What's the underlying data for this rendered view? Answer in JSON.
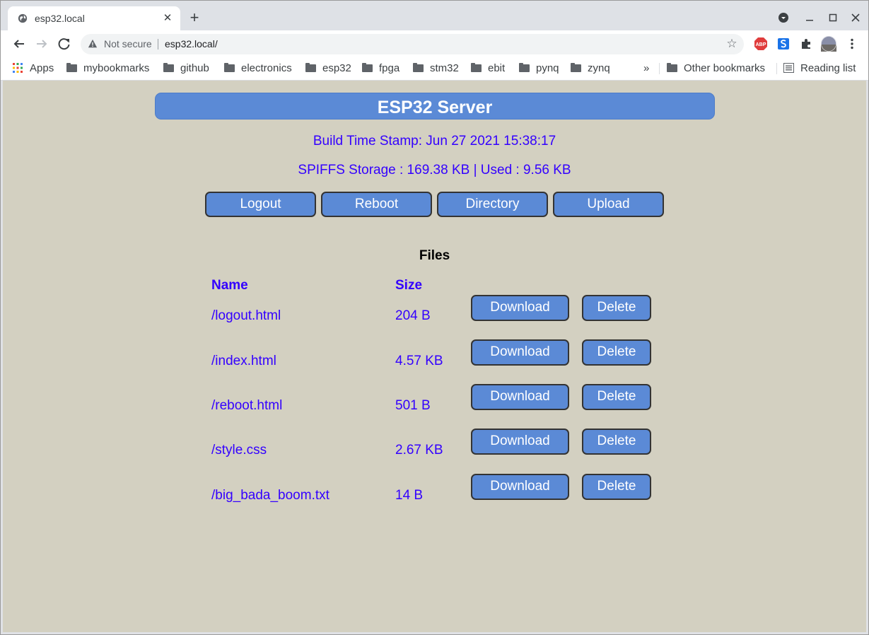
{
  "browser": {
    "tab_title": "esp32.local",
    "tab_close": "✕",
    "new_tab": "+",
    "security_label": "Not secure",
    "url": "esp32.local/",
    "bookmarks": [
      {
        "label": "Apps",
        "icon": "apps-icon"
      },
      {
        "label": "mybookmarks",
        "icon": "folder-icon"
      },
      {
        "label": "github",
        "icon": "folder-icon"
      },
      {
        "label": "electronics",
        "icon": "folder-icon"
      },
      {
        "label": "esp32",
        "icon": "folder-icon"
      },
      {
        "label": "fpga",
        "icon": "folder-icon"
      },
      {
        "label": "stm32",
        "icon": "folder-icon"
      },
      {
        "label": "ebit",
        "icon": "folder-icon"
      },
      {
        "label": "pynq",
        "icon": "folder-icon"
      },
      {
        "label": "zynq",
        "icon": "folder-icon"
      }
    ],
    "overflow": "»",
    "other_bookmarks": "Other bookmarks",
    "reading_list": "Reading list",
    "extension_abp": "ABP"
  },
  "page": {
    "title": "ESP32 Server",
    "build_stamp": "Build Time Stamp: Jun 27 2021 15:38:17",
    "storage": "SPIFFS Storage : 169.38 KB | Used : 9.56 KB",
    "nav": {
      "logout": "Logout",
      "reboot": "Reboot",
      "directory": "Directory",
      "upload": "Upload"
    },
    "files_heading": "Files",
    "columns": {
      "name": "Name",
      "size": "Size"
    },
    "files": [
      {
        "name": "/logout.html",
        "size": "204 B",
        "download": "Download",
        "delete": "Delete"
      },
      {
        "name": "/index.html",
        "size": "4.57 KB",
        "download": "Download",
        "delete": "Delete"
      },
      {
        "name": "/reboot.html",
        "size": "501 B",
        "download": "Download",
        "delete": "Delete"
      },
      {
        "name": "/style.css",
        "size": "2.67 KB",
        "download": "Download",
        "delete": "Delete"
      },
      {
        "name": "/big_bada_boom.txt",
        "size": "14 B",
        "download": "Download",
        "delete": "Delete"
      }
    ]
  },
  "colors": {
    "page_background": "#d3d0c1",
    "button_blue": "#5b8ad6",
    "text_blue": "#3300ff"
  }
}
